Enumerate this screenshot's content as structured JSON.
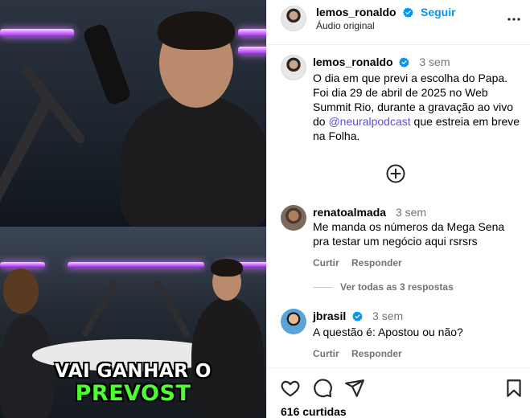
{
  "media": {
    "caption_line1": "VAI GANHAR O",
    "caption_line2": "PREVOST",
    "caption_line2_color": "#4cff2e",
    "accent_neon": "#c65cff"
  },
  "header": {
    "username": "lemos_ronaldo",
    "follow_label": "Seguir",
    "subtitle": "Áudio original",
    "verified_icon": "verified-badge-icon",
    "more_icon": "more-options-icon"
  },
  "post": {
    "username": "lemos_ronaldo",
    "time": "3 sem",
    "text_before": "O dia em que previ a escolha do Papa. Foi dia 29 de abril de 2025 no Web Summit Rio, durante a gravação ao vivo do ",
    "mention": "@neuralpodcast",
    "text_after": " que estreia em breve na Folha."
  },
  "add_icon": "add-circle-icon",
  "comments": [
    {
      "username": "renatoalmada",
      "time": "3 sem",
      "text": "Me manda os números da Mega Sena pra testar um negócio aqui rsrsrs",
      "reply_label": "Curtir",
      "respond_label": "Responder",
      "verified": false
    },
    {
      "username": "jbrasil",
      "time": "3 sem",
      "text": "A questão é: Apostou ou não?",
      "reply_label": "Curtir",
      "respond_label": "Responder",
      "verified": true
    }
  ],
  "view_replies_label": "Ver todas as 3 respostas",
  "footer": {
    "like_icon": "heart-icon",
    "comment_icon": "comment-icon",
    "share_icon": "send-icon",
    "save_icon": "bookmark-icon",
    "likes_label": "616 curtidas"
  },
  "colors": {
    "link_blue": "#0095f6",
    "mention_purple": "#5b51d8",
    "muted": "#737373"
  }
}
